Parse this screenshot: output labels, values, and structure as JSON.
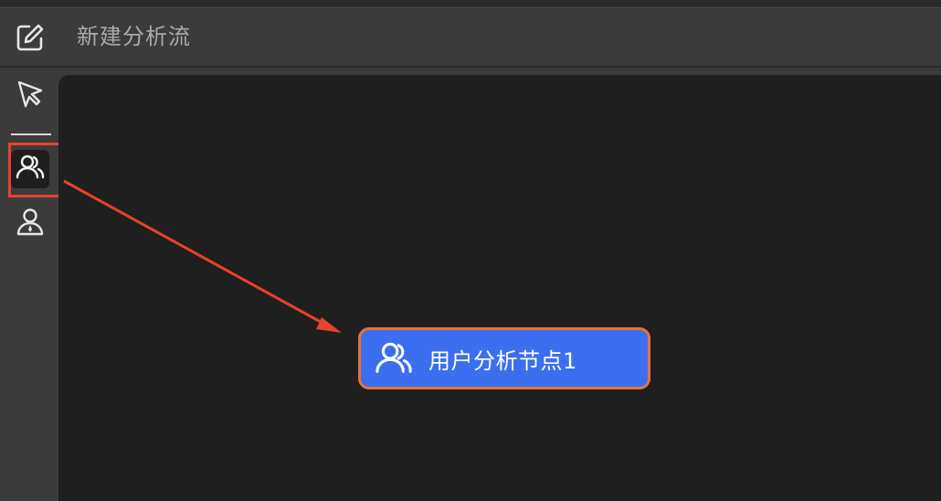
{
  "header": {
    "title": "新建分析流",
    "edit_icon": "edit-icon"
  },
  "toolbar": {
    "items": [
      {
        "name": "pointer-tool",
        "icon": "cursor-arrow-icon"
      },
      {
        "name": "user-group-tool",
        "icon": "user-group-icon",
        "selected": true
      },
      {
        "name": "user-tool",
        "icon": "user-icon"
      }
    ]
  },
  "canvas": {
    "node": {
      "label": "用户分析节点1",
      "icon": "user-group-icon"
    }
  },
  "colors": {
    "highlight": "#e8412c",
    "node_fill": "#3b6ff0",
    "node_border": "#e8723c",
    "canvas_bg": "#1f1f1f",
    "panel_bg": "#3b3b3b"
  }
}
